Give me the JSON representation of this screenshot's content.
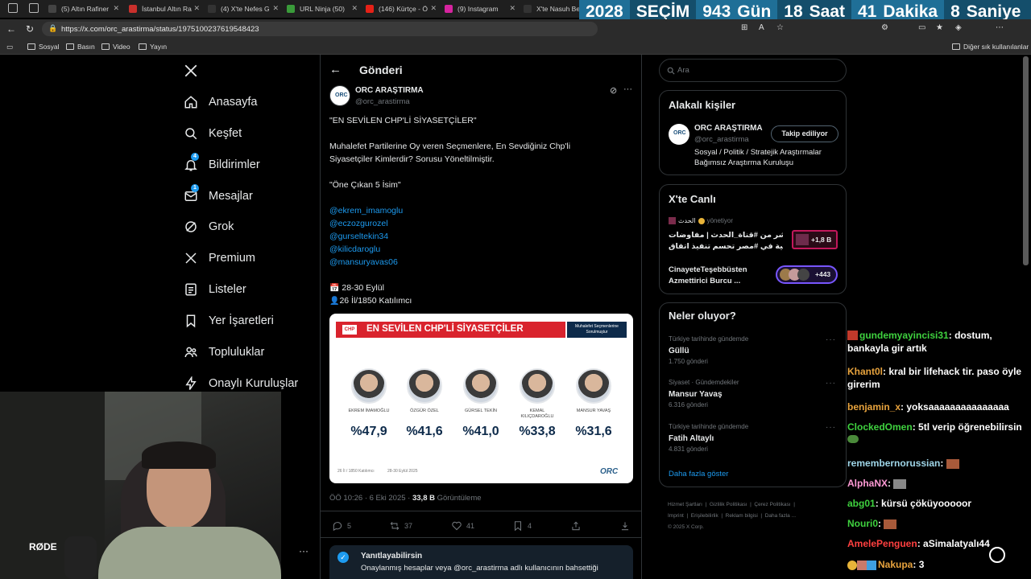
{
  "browser": {
    "tabs": [
      {
        "title": "(5) Altın Rafiner",
        "fav": "#444"
      },
      {
        "title": "İstanbul Altın Ra",
        "fav": "#c9302c"
      },
      {
        "title": "(4) X'te Nefes G",
        "fav": "#333"
      },
      {
        "title": "URL Ninja (50)",
        "fav": "#3a9b3a"
      },
      {
        "title": "(146) Kürtçe - Ö",
        "fav": "#e62117"
      },
      {
        "title": "(9) Instagram",
        "fav": "#d6249f"
      },
      {
        "title": "X'te Nasuh Bei",
        "fav": "#333"
      }
    ],
    "url": "https://x.com/orc_arastirma/status/1975100237619548423",
    "bookmarks": [
      "Sosyal",
      "Basın",
      "Video",
      "Yayın"
    ],
    "bookmarks_right": "Diğer sık kullanılanlar"
  },
  "countdown": {
    "year": "2028",
    "label": "SEÇİM",
    "days": "943",
    "days_label": "Gün",
    "hours": "18",
    "hours_label": "Saat",
    "minutes": "41",
    "minutes_label": "Dakika",
    "seconds": "8",
    "seconds_label": "Saniye"
  },
  "nav": {
    "items": [
      {
        "label": "Anasayfa",
        "icon": "home-icon"
      },
      {
        "label": "Keşfet",
        "icon": "search-icon"
      },
      {
        "label": "Bildirimler",
        "icon": "bell-icon",
        "badge": "4"
      },
      {
        "label": "Mesajlar",
        "icon": "mail-icon",
        "badge": "1"
      },
      {
        "label": "Grok",
        "icon": "grok-icon"
      },
      {
        "label": "Premium",
        "icon": "x-icon"
      },
      {
        "label": "Listeler",
        "icon": "list-icon"
      },
      {
        "label": "Yer İşaretleri",
        "icon": "bookmark-icon"
      },
      {
        "label": "Topluluklar",
        "icon": "people-icon"
      },
      {
        "label": "Onaylı Kuruluşlar",
        "icon": "lightning-icon"
      }
    ],
    "more": "···"
  },
  "post": {
    "header": "Gönderi",
    "author_name": "ORC ARAŞTIRMA",
    "author_handle": "@orc_arastirma",
    "lines": [
      "\"EN SEVİLEN CHP'Lİ SİYASETÇİLER\"",
      "Muhalefet Partilerine Oy veren Seçmenlere, En Sevdiğiniz Chp'li",
      "Siyasetçiler Kimlerdir? Sorusu Yöneltilmiştir.",
      "\"Öne Çıkan 5 İsim\""
    ],
    "mentions": [
      "@ekrem_imamoglu",
      "@eczozgurozel",
      "@gurseltekin34",
      "@kilicdaroglu",
      "@mansuryavas06"
    ],
    "dates": "28-30 Eylül",
    "participants": "26 İl/1850 Katılımcı",
    "timestamp": "ÖÖ 10:26 · 6 Eki 2025 ·",
    "views": "33,8 B",
    "views_label": "Görüntüleme",
    "stats": {
      "replies": "5",
      "reposts": "37",
      "likes": "41",
      "bookmarks": "4"
    },
    "reply_notice_title": "Yanıtlayabilirsin",
    "reply_notice_text": "Onaylanmış hesaplar veya @orc_arastirma adlı kullanıcının bahsettiği"
  },
  "graphic": {
    "title": "EN SEVİLEN CHP'Lİ SİYASETÇİLER",
    "logo": "CHP",
    "note": "Muhalefet Seçmenlerine Sorulmuştur",
    "people": [
      {
        "name": "EKREM İMAMOĞLU",
        "pct": "%47,9"
      },
      {
        "name": "ÖZGÜR ÖZEL",
        "pct": "%41,6"
      },
      {
        "name": "GÜRSEL TEKİN",
        "pct": "%41,0"
      },
      {
        "name": "KEMAL KILIÇDAROĞLU",
        "pct": "%33,8"
      },
      {
        "name": "MANSUR YAVAŞ",
        "pct": "%31,6"
      }
    ],
    "footer_left": "26 İl / 1850 Katılımcı",
    "footer_mid": "28-30 Eylül 2025",
    "brand": "ORC"
  },
  "right": {
    "search_placeholder": "Ara",
    "related_title": "Alakalı kişiler",
    "related": {
      "name": "ORC ARAŞTIRMA",
      "handle": "@orc_arastirma",
      "follow": "Takip ediliyor",
      "bio1": "Sosyal / Politik / Stratejik Araştırmalar",
      "bio2": "Bağımsız Araştırma Kuruluşu"
    },
    "live_title": "X'te Canlı",
    "live1": {
      "host": "الحدث",
      "role": "yönetiyor",
      "line1": "مباشر من #قناة_الحدث | مفاوضات",
      "line2": "فنية في #مصر تحسم تنفيذ اتفاق ...",
      "count": "+1,8 B"
    },
    "live2": {
      "line1": "CinayeteTeşebbüsten",
      "line2": "Azmettirici Burcu ...",
      "count": "+443"
    },
    "trends_title": "Neler oluyor?",
    "trends": [
      {
        "context": "Türkiye tarihinde gündemde",
        "title": "Güllü",
        "count": "1.750 gönderi"
      },
      {
        "context": "Siyaset · Gündemdekiler",
        "title": "Mansur Yavaş",
        "count": "6.316 gönderi"
      },
      {
        "context": "Türkiye tarihinde gündemde",
        "title": "Fatih Altaylı",
        "count": "4.831 gönderi"
      }
    ],
    "show_more": "Daha fazla göster",
    "footer": [
      "Hizmet Şartları",
      "Gizlilik Politikası",
      "Çerez Politikası",
      "Imprint",
      "Erişilebilirlik",
      "Reklam bilgisi",
      "Daha fazla ...",
      "© 2025 X Corp."
    ]
  },
  "chat": [
    {
      "user": "gundemyayincisi31",
      "msg": "dostum, bankayla gir artık",
      "color": "#3fd23f"
    },
    {
      "user": "Khant0l",
      "msg": "kral bir lifehack tir. paso öyle girerim",
      "color": "#e8a33d"
    },
    {
      "user": "benjamin_x",
      "msg": "yoksaaaaaaaaaaaaaaa",
      "color": "#e8a33d"
    },
    {
      "user": "ClockedOmen",
      "msg": "5tl verip öğrenebilirsin",
      "color": "#3fd23f"
    },
    {
      "user": "remembernorussian",
      "msg": "",
      "color": "#9fd6e8"
    },
    {
      "user": "AlphaNX",
      "msg": "",
      "color": "#ff9ad5"
    },
    {
      "user": "abg01",
      "msg": "kürsü çöküyooooor",
      "color": "#3fd23f"
    },
    {
      "user": "Nouri0",
      "msg": "",
      "color": "#3fd23f"
    },
    {
      "user": "AmelePenguen",
      "msg": "aSimalatyalı44",
      "color": "#ff4040"
    },
    {
      "user": "Nakupa",
      "msg": "3",
      "color": "#e8a33d"
    }
  ],
  "colors": {
    "accent": "#1d9bf0",
    "countdown": "#1f6f97",
    "chp_red": "#d9232d"
  }
}
